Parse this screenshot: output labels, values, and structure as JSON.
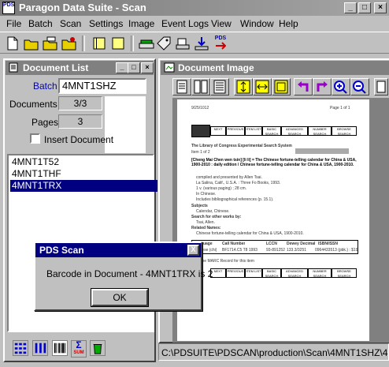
{
  "app": {
    "title": "Paragon Data Suite - Scan",
    "icon_text": "PDS"
  },
  "menu": [
    "File",
    "Batch",
    "Scan",
    "Settings",
    "Image",
    "Event Logs",
    "View",
    "Window",
    "Help"
  ],
  "toolbar": {
    "pds_badge": "PDS"
  },
  "document_list": {
    "title": "Document List",
    "batch_label": "Batch",
    "batch_value": "4MNT1SHZ",
    "documents_label": "Documents",
    "documents_value": "3/3",
    "pages_label": "Pages",
    "pages_value": "3",
    "insert_label": "Insert Document",
    "items": [
      "4MNT1T52",
      "4MNT1THF",
      "4MNT1TRX"
    ],
    "selected_index": 2,
    "sum_label": "SUM"
  },
  "document_image": {
    "title": "Document Image",
    "status_path": "C:\\PDSUITE\\PDSCAN\\production\\Scan\\4MNT1SHZ\\4",
    "page": {
      "date": "9/25/1012",
      "page_of": "Page 1 of 1",
      "nav": [
        "NEXT",
        "PREVIOUS",
        "ITEM LIST",
        "BASIC SEARCH",
        "ADVANCED SEARCH",
        "NUMBER SEARCH",
        "BROWSE SEARCH"
      ],
      "header": "The Library of Congress Experimental Search System",
      "item": "Item 1 of 2",
      "record_title": "[Cheng Mai Chen wen tsin] [li li] = The Chinese fortune-telling calendar for China & USA, 1900-2010 : daily edition / Chinese fortune-telling calendar for China & USA, 1900-2010.",
      "lines": [
        "compiled and presented by Allen Tsai.",
        "La Salina, Calif., U.S.A. : Three Fo Books, 1993.",
        "1 v. (various paging) ; 28 cm.",
        "In Chinese.",
        "Includes bibliographical references (p. 15.1)."
      ],
      "subjects_label": "Subjects",
      "subjects": "Calendar, Chinese.",
      "search_label": "Search for other works by:",
      "search_value": "Tsai, Allen.",
      "related_label": "Related Names:",
      "related_value": "Chinese fortune-telling calendar for China & USA, 1900-2010.",
      "table_headers": [
        "Language",
        "Call Number",
        "LCCN",
        "Dewey Decimal",
        "ISBN/ISSN"
      ],
      "table_row": [
        "Chinese (chi)",
        "BF1714.C5 T8 1993",
        "93-891252",
        "133.3/3251",
        "0964433513 (pbk.) : $19.95"
      ],
      "footer_link": "View the MARC Record for this item"
    }
  },
  "dialog": {
    "title": "PDS Scan",
    "message": "Barcode in Document - 4MNT1TRX is 2",
    "ok_label": "OK",
    "close_label": "X"
  },
  "colors": {
    "selection": "#000080",
    "titlebar_inactive": "#808080",
    "dialog_title": "#000080"
  }
}
